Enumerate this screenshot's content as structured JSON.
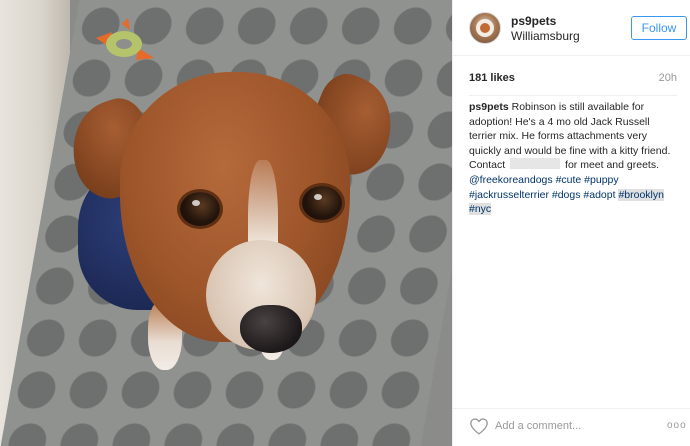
{
  "header": {
    "username": "ps9pets",
    "location": "Williamsburg",
    "follow_label": "Follow"
  },
  "stats": {
    "likes": "181 likes",
    "time_ago": "20h"
  },
  "caption": {
    "username": "ps9pets",
    "text_part1": " Robinson is still available for adoption! He's a 4 mo old Jack Russell terrier mix. He forms attachments very quickly and would be fine with a kitty friend. Contact ",
    "text_part2": " for meet and greets. ",
    "mention": "@freekoreandogs",
    "hashtags": [
      "#cute",
      "#puppy",
      "#jackrusselterrier",
      "#dogs",
      "#adopt"
    ],
    "highlighted_hashtags": [
      "#brooklyn",
      "#nyc"
    ]
  },
  "footer": {
    "comment_placeholder": "Add a comment...",
    "more_label": "ooo"
  },
  "colors": {
    "accent": "#3897f0",
    "link": "#003569",
    "muted": "#999999",
    "text": "#262626"
  },
  "icons": {
    "like": "heart-icon",
    "more": "more-icon"
  }
}
